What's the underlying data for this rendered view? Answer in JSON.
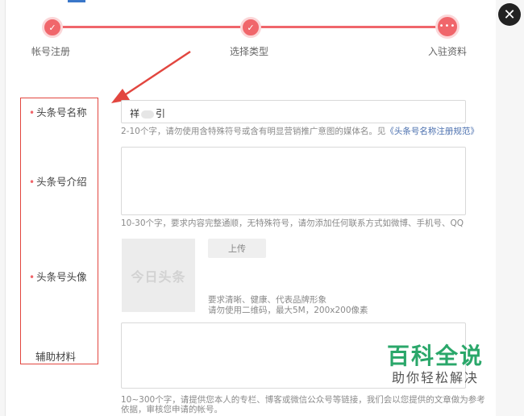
{
  "steps": [
    {
      "label": "帐号注册",
      "status_icon": "check-icon",
      "glyph": "✓"
    },
    {
      "label": "选择类型",
      "status_icon": "check-icon",
      "glyph": "✓"
    },
    {
      "label": "入驻资料",
      "status_icon": "ellipsis-icon",
      "glyph": "•••"
    }
  ],
  "close": {
    "glyph": "✕"
  },
  "form": {
    "name": {
      "label": "头条号名称",
      "value_prefix": "祥",
      "value_suffix": "引",
      "hint": "2-10个字，请勿使用含特殊符号或含有明显营销推广意图的媒体名。见",
      "hint_link": "《头条号名称注册规范》"
    },
    "intro": {
      "label": "头条号介绍",
      "value": "",
      "hint": "10-30个字，要求内容完整通顺，无特殊符号，请勿添加任何联系方式如微博、手机号、QQ"
    },
    "avatar": {
      "label": "头条号头像",
      "placeholder_text": "今日头条",
      "upload_label": "上传",
      "hint_line1": "要求清晰、健康、代表品牌形象",
      "hint_line2": "请勿使用二维码，最大5M，200x200像素"
    },
    "materials": {
      "label": "辅助材料",
      "value": "",
      "hint_line1": "10~300个字，请提供您本人的专栏、博客或微信公众号等链接，我们会以您提供的文章做为参考",
      "hint_line2": "依据，审核您申请的帐号。"
    },
    "required_mark": "•"
  },
  "watermark": {
    "title": "百科全说",
    "subtitle": "助你轻松解决"
  },
  "colors": {
    "accent": "#f0666b",
    "highlight": "#e2463f",
    "link": "#4a6fae",
    "watermark": "#2aa76a"
  }
}
